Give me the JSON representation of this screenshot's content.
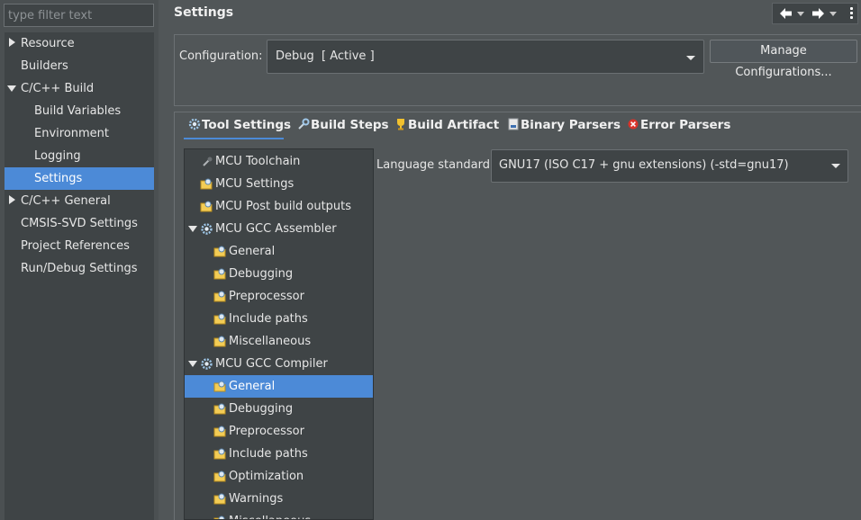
{
  "sidebar": {
    "filter_placeholder": "type filter text",
    "items": [
      {
        "label": "Resource",
        "twisty": "collapsed"
      },
      {
        "label": "Builders",
        "twisty": "none"
      },
      {
        "label": "C/C++ Build",
        "twisty": "expanded"
      },
      {
        "label": "Build Variables",
        "twisty": "none"
      },
      {
        "label": "Environment",
        "twisty": "none"
      },
      {
        "label": "Logging",
        "twisty": "none"
      },
      {
        "label": "Settings",
        "twisty": "none",
        "selected": true
      },
      {
        "label": "C/C++ General",
        "twisty": "collapsed"
      },
      {
        "label": "CMSIS-SVD Settings",
        "twisty": "none"
      },
      {
        "label": "Project References",
        "twisty": "none"
      },
      {
        "label": "Run/Debug Settings",
        "twisty": "none"
      }
    ]
  },
  "header": {
    "title": "Settings",
    "nav_icons": [
      "back-arrow-icon",
      "forward-arrow-icon",
      "view-menu-icon"
    ]
  },
  "configuration": {
    "label": "Configuration:",
    "value": "Debug  [ Active ]",
    "manage_label": "Manage Configurations..."
  },
  "tabs": [
    {
      "label": "Tool Settings",
      "icon": "tool-settings-icon",
      "active": true
    },
    {
      "label": "Build Steps",
      "icon": "build-steps-icon",
      "active": false
    },
    {
      "label": "Build Artifact",
      "icon": "build-artifact-icon",
      "active": false
    },
    {
      "label": "Binary Parsers",
      "icon": "binary-parsers-icon",
      "active": false
    },
    {
      "label": "Error Parsers",
      "icon": "error-parsers-icon",
      "active": false
    }
  ],
  "tool_tree": [
    {
      "label": "MCU Toolchain",
      "icon": "toolchain-icon",
      "twisty": "none"
    },
    {
      "label": "MCU Settings",
      "icon": "option-category-icon",
      "twisty": "none"
    },
    {
      "label": "MCU Post build outputs",
      "icon": "option-category-icon",
      "twisty": "none"
    },
    {
      "label": "MCU GCC Assembler",
      "icon": "tool-gear-icon",
      "twisty": "expanded"
    },
    {
      "label": "General",
      "icon": "option-category-icon",
      "twisty": "none"
    },
    {
      "label": "Debugging",
      "icon": "option-category-icon",
      "twisty": "none"
    },
    {
      "label": "Preprocessor",
      "icon": "option-category-icon",
      "twisty": "none"
    },
    {
      "label": "Include paths",
      "icon": "option-category-icon",
      "twisty": "none"
    },
    {
      "label": "Miscellaneous",
      "icon": "option-category-icon",
      "twisty": "none"
    },
    {
      "label": "MCU GCC Compiler",
      "icon": "tool-gear-icon",
      "twisty": "expanded"
    },
    {
      "label": "General",
      "icon": "option-category-icon",
      "twisty": "none",
      "selected": true
    },
    {
      "label": "Debugging",
      "icon": "option-category-icon",
      "twisty": "none"
    },
    {
      "label": "Preprocessor",
      "icon": "option-category-icon",
      "twisty": "none"
    },
    {
      "label": "Include paths",
      "icon": "option-category-icon",
      "twisty": "none"
    },
    {
      "label": "Optimization",
      "icon": "option-category-icon",
      "twisty": "none"
    },
    {
      "label": "Warnings",
      "icon": "option-category-icon",
      "twisty": "none"
    },
    {
      "label": "Miscellaneous",
      "icon": "option-category-icon",
      "twisty": "none"
    }
  ],
  "language_standard": {
    "label": "Language standard",
    "value": "GNU17 (ISO C17 + gnu extensions) (-std=gnu17)"
  },
  "colors": {
    "background": "#515658",
    "panel": "#3f4446",
    "selection": "#4c8ad7",
    "text": "#e6e6e6"
  }
}
